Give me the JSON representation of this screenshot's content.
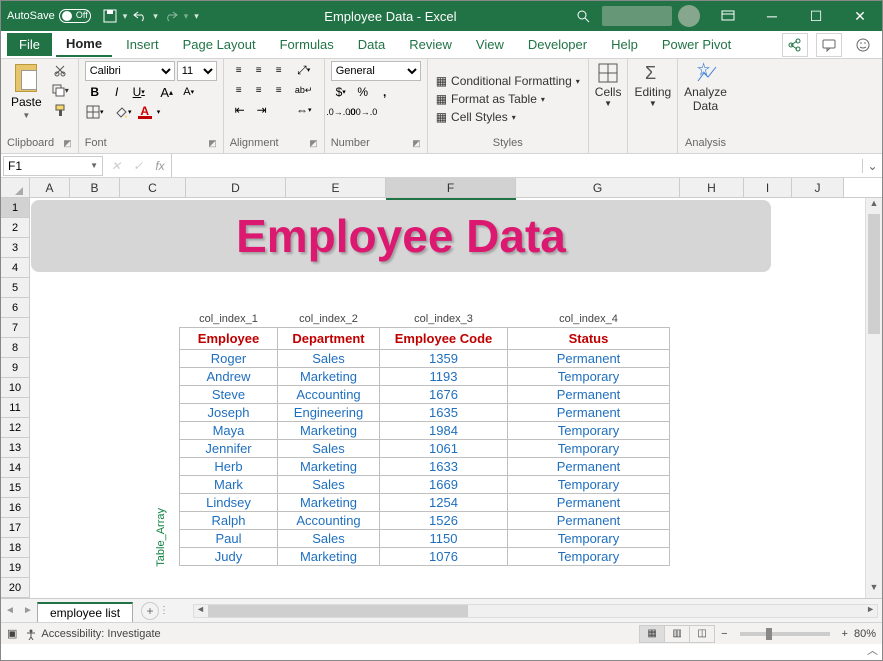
{
  "titlebar": {
    "autosave_label": "AutoSave",
    "autosave_state": "Off",
    "doc_title": "Employee Data  -  Excel"
  },
  "ribbon_tabs": {
    "file": "File",
    "home": "Home",
    "insert": "Insert",
    "page_layout": "Page Layout",
    "formulas": "Formulas",
    "data": "Data",
    "review": "Review",
    "view": "View",
    "developer": "Developer",
    "help": "Help",
    "power_pivot": "Power Pivot"
  },
  "ribbon": {
    "clipboard": {
      "label": "Clipboard",
      "paste": "Paste"
    },
    "font": {
      "label": "Font",
      "family": "Calibri",
      "size": "11"
    },
    "alignment": {
      "label": "Alignment"
    },
    "number": {
      "label": "Number",
      "format": "General"
    },
    "styles": {
      "label": "Styles",
      "cond": "Conditional Formatting",
      "table": "Format as Table",
      "cell": "Cell Styles"
    },
    "cells": {
      "label": "Cells"
    },
    "editing": {
      "label": "Editing"
    },
    "analysis": {
      "label": "Analysis",
      "analyze": "Analyze",
      "data": "Data"
    }
  },
  "fxbar": {
    "name": "F1"
  },
  "banner": "Employee Data",
  "vert_label": "Table_Array",
  "col_index_labels": [
    "col_index_1",
    "col_index_2",
    "col_index_3",
    "col_index_4"
  ],
  "table_headers": [
    "Employee",
    "Department",
    "Employee Code",
    "Status"
  ],
  "table_rows": [
    [
      "Roger",
      "Sales",
      "1359",
      "Permanent"
    ],
    [
      "Andrew",
      "Marketing",
      "1193",
      "Temporary"
    ],
    [
      "Steve",
      "Accounting",
      "1676",
      "Permanent"
    ],
    [
      "Joseph",
      "Engineering",
      "1635",
      "Permanent"
    ],
    [
      "Maya",
      "Marketing",
      "1984",
      "Temporary"
    ],
    [
      "Jennifer",
      "Sales",
      "1061",
      "Temporary"
    ],
    [
      "Herb",
      "Marketing",
      "1633",
      "Permanent"
    ],
    [
      "Mark",
      "Sales",
      "1669",
      "Temporary"
    ],
    [
      "Lindsey",
      "Marketing",
      "1254",
      "Permanent"
    ],
    [
      "Ralph",
      "Accounting",
      "1526",
      "Permanent"
    ],
    [
      "Paul",
      "Sales",
      "1150",
      "Temporary"
    ],
    [
      "Judy",
      "Marketing",
      "1076",
      "Temporary"
    ]
  ],
  "columns": [
    "A",
    "B",
    "C",
    "D",
    "E",
    "F",
    "G",
    "H",
    "I",
    "J"
  ],
  "sheet_tab": "employee list",
  "statusbar": {
    "ready": "",
    "accessibility": "Accessibility: Investigate",
    "zoom": "80%"
  }
}
